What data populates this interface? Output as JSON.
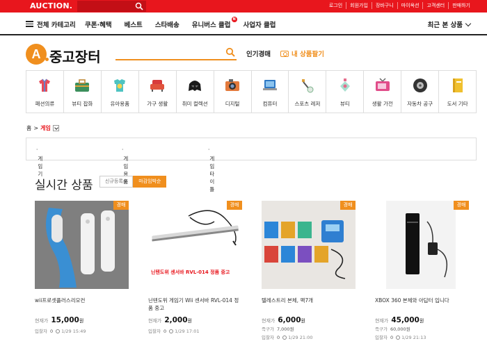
{
  "topbar": {
    "logo": "AUCTION.",
    "links": [
      "로그인",
      "회원가입",
      "장바구니",
      "마이옥션",
      "고객센터",
      "판매하기"
    ]
  },
  "nav": {
    "all_categories": "전체 카테고리",
    "items": [
      "쿠폰·혜택",
      "베스트",
      "스타배송",
      "유니버스 클럽",
      "사업자 클럽"
    ],
    "universe_badge": "N",
    "recent": "최근 본 상품"
  },
  "brand": {
    "logo_letter": "A",
    "title": "중고장터",
    "popular": "인기경매",
    "sell": "내 상품팔기"
  },
  "categories": [
    {
      "label": "패션의류",
      "icon": "fashion-icon"
    },
    {
      "label": "뷰티 잡화",
      "icon": "beauty-bag-icon"
    },
    {
      "label": "유아용품",
      "icon": "baby-icon"
    },
    {
      "label": "가구 생활",
      "icon": "sofa-icon"
    },
    {
      "label": "취미 컬렉션",
      "icon": "helmet-icon"
    },
    {
      "label": "디지털",
      "icon": "camera-icon"
    },
    {
      "label": "컴퓨터",
      "icon": "laptop-icon"
    },
    {
      "label": "스포츠 레저",
      "icon": "golf-icon"
    },
    {
      "label": "뷰티",
      "icon": "perfume-icon"
    },
    {
      "label": "생활 가전",
      "icon": "tv-icon"
    },
    {
      "label": "자동차 공구",
      "icon": "tire-icon"
    },
    {
      "label": "도서 기타",
      "icon": "book-icon"
    }
  ],
  "breadcrumb": {
    "home": "홈",
    "separator": ">",
    "current": "게임"
  },
  "subcategories": [
    "게임기",
    "게임용품",
    "게임타이틀"
  ],
  "section": {
    "title": "실시간 상품",
    "tabs": [
      "신규등록순",
      "마감임박순"
    ],
    "active_tab": "마감임박순"
  },
  "labels": {
    "current_price": "현재가",
    "start_price": "즉구가",
    "bidders": "입찰자",
    "auction_tag": "경매",
    "won": "원"
  },
  "products": [
    {
      "name": "wii프로셋플러스리모컨",
      "price": "15,000",
      "start_price": "",
      "bidders": "0",
      "end": "1/29 15:49",
      "tag": "경매"
    },
    {
      "name": "닌텐도위 게임기 Wii 센서바 RVL-014 정품 중고",
      "price": "2,000",
      "start_price": "",
      "bidders": "0",
      "end": "1/29 17:01",
      "tag": "경매",
      "caption": "닌텐도위 센서바 RVL-014 정품 중고"
    },
    {
      "name": "텔레스트리 본체, 팩7개",
      "price": "6,000",
      "start_price": "7,000",
      "bidders": "0",
      "end": "1/29 21:00",
      "tag": "경매"
    },
    {
      "name": "XBOX 360 본체와 아답터 입니다",
      "price": "45,000",
      "start_price": "60,000",
      "bidders": "0",
      "end": "1/29 21:13",
      "tag": "경매"
    }
  ]
}
